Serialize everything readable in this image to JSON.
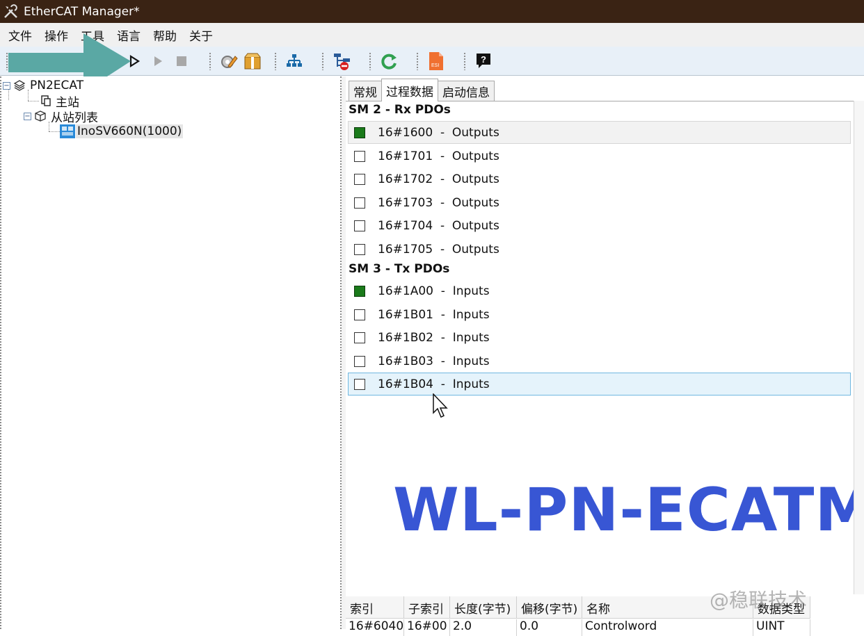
{
  "window": {
    "title": "EtherCAT Manager*"
  },
  "menu": [
    "文件",
    "操作",
    "工具",
    "语言",
    "帮助",
    "关于"
  ],
  "toolbar": {
    "icons": [
      "connect-icon",
      "play-outline-icon",
      "play-icon",
      "stop-icon",
      "edit-settings-icon",
      "package-icon",
      "network-scan-icon",
      "remove-icon",
      "refresh-icon",
      "esi-file-icon",
      "help-icon"
    ],
    "esi_label": "ESI",
    "help_label": "?"
  },
  "tree": {
    "root": "PN2ECAT",
    "master": "主站",
    "slave_list": "从站列表",
    "slave_device": "InoSV660N(1000)"
  },
  "tabs": [
    "常规",
    "过程数据",
    "启动信息"
  ],
  "active_tab": "过程数据",
  "pdo": {
    "sm2_header": "SM 2 - Rx PDOs",
    "sm3_header": "SM 3 - Tx PDOs",
    "rx": [
      {
        "index": "16#1600",
        "type": "Outputs",
        "checked": true
      },
      {
        "index": "16#1701",
        "type": "Outputs",
        "checked": false
      },
      {
        "index": "16#1702",
        "type": "Outputs",
        "checked": false
      },
      {
        "index": "16#1703",
        "type": "Outputs",
        "checked": false
      },
      {
        "index": "16#1704",
        "type": "Outputs",
        "checked": false
      },
      {
        "index": "16#1705",
        "type": "Outputs",
        "checked": false
      }
    ],
    "tx": [
      {
        "index": "16#1A00",
        "type": "Inputs",
        "checked": true
      },
      {
        "index": "16#1B01",
        "type": "Inputs",
        "checked": false
      },
      {
        "index": "16#1B02",
        "type": "Inputs",
        "checked": false
      },
      {
        "index": "16#1B03",
        "type": "Inputs",
        "checked": false
      },
      {
        "index": "16#1B04",
        "type": "Inputs",
        "checked": false
      }
    ]
  },
  "overlay_text": "WL-PN-ECATM",
  "table": {
    "headers": [
      "索引",
      "子索引",
      "长度(字节)",
      "偏移(字节)",
      "名称",
      "数据类型"
    ],
    "rows": [
      [
        "16#6040",
        "16#00",
        "2.0",
        "0.0",
        "Controlword",
        "UINT"
      ]
    ]
  },
  "watermark": "@稳联技术",
  "colors": {
    "title_bar": "#3a2314",
    "checked_box": "#1a7a1a",
    "overlay_text": "#3856d4",
    "annotation_arrow": "#5aa8a4",
    "selected_row": "#e5f3fb"
  }
}
